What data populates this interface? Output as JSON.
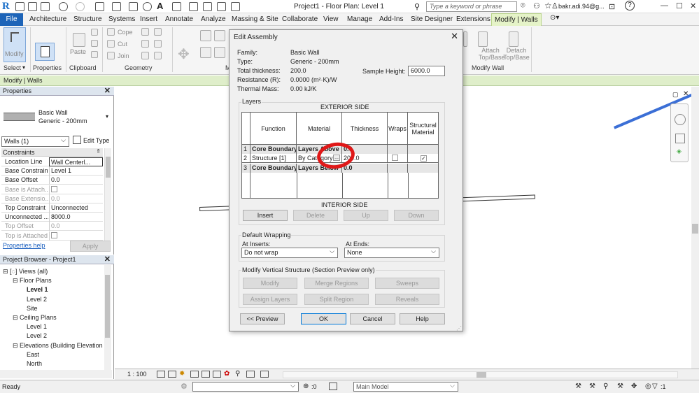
{
  "titlebar": {
    "logo": "R",
    "title": "Project1 - Floor Plan: Level 1",
    "search_placeholder": "Type a keyword or phrase",
    "user": "bakr.adi.94@g...",
    "help": "?",
    "minimize": "—",
    "maximize": "☐",
    "close": "✕"
  },
  "tabs": [
    "File",
    "Architecture",
    "Structure",
    "Systems",
    "Insert",
    "Annotate",
    "Analyze",
    "Massing & Site",
    "Collaborate",
    "View",
    "Manage",
    "Add-Ins",
    "Site Designer",
    "Extensions",
    "Modify | Walls"
  ],
  "ribbon": {
    "modify_label": "Modify",
    "paste_label": "Paste",
    "cope_label": "Cope",
    "cut_label": "Cut",
    "join_label": "Join",
    "attach_label": "Attach Top/Base",
    "detach_label": "Detach Top/Base",
    "group_select": "Select",
    "group_properties": "Properties",
    "group_clipboard": "Clipboard",
    "group_geometry": "Geometry",
    "group_modify": "M",
    "group_modify_wall": "Modify Wall"
  },
  "context": {
    "text": "Modify | Walls"
  },
  "properties": {
    "header": "Properties",
    "type_family": "Basic Wall",
    "type_name": "Generic - 200mm",
    "instance_selector": "Walls (1)",
    "edit_type": "Edit Type",
    "section": "Constraints",
    "rows": [
      {
        "k": "Location Line",
        "v": "Wall Centerl...",
        "dim": false
      },
      {
        "k": "Base Constraint",
        "v": "Level 1",
        "dim": false
      },
      {
        "k": "Base Offset",
        "v": "0.0",
        "dim": false
      },
      {
        "k": "Base is Attach...",
        "v": "",
        "dim": true,
        "check": true
      },
      {
        "k": "Base Extensio...",
        "v": "0.0",
        "dim": true
      },
      {
        "k": "Top Constraint",
        "v": "Unconnected",
        "dim": false
      },
      {
        "k": "Unconnected ...",
        "v": "8000.0",
        "dim": false
      },
      {
        "k": "Top Offset",
        "v": "0.0",
        "dim": true
      },
      {
        "k": "Top is Attached",
        "v": "",
        "dim": true,
        "check": true
      }
    ],
    "help_link": "Properties help",
    "apply": "Apply"
  },
  "browser": {
    "header": "Project Browser - Project1",
    "items": [
      {
        "label": "Views (all)",
        "level": 0
      },
      {
        "label": "Floor Plans",
        "level": 1
      },
      {
        "label": "Level 1",
        "level": 2,
        "bold": true
      },
      {
        "label": "Level 2",
        "level": 2
      },
      {
        "label": "Site",
        "level": 2
      },
      {
        "label": "Ceiling Plans",
        "level": 1
      },
      {
        "label": "Level 1",
        "level": 2
      },
      {
        "label": "Level 2",
        "level": 2
      },
      {
        "label": "Elevations (Building Elevation",
        "level": 1
      },
      {
        "label": "East",
        "level": 2
      },
      {
        "label": "North",
        "level": 2
      }
    ]
  },
  "viewbar": {
    "scale": "1 : 100"
  },
  "statusbar": {
    "status": "Ready",
    "zero": ":0",
    "model": "Main Model",
    "filter": ":1"
  },
  "dialog": {
    "title": "Edit Assembly",
    "family_label": "Family:",
    "family_value": "Basic Wall",
    "type_label": "Type:",
    "type_value": "Generic - 200mm",
    "thickness_label": "Total thickness:",
    "thickness_value": "200.0",
    "resistance_label": "Resistance (R):",
    "resistance_value": "0.0000 (m²·K)/W",
    "mass_label": "Thermal Mass:",
    "mass_value": "0.00 kJ/K",
    "sample_height_label": "Sample Height:",
    "sample_height_value": "6000.0",
    "layers_label": "Layers",
    "exterior_side": "EXTERIOR SIDE",
    "interior_side": "INTERIOR SIDE",
    "columns": [
      "Function",
      "Material",
      "Thickness",
      "Wraps",
      "Structural Material"
    ],
    "rows": [
      {
        "n": "1",
        "function": "Core Boundary",
        "material": "Layers Above",
        "thickness": "0.0",
        "core": true
      },
      {
        "n": "2",
        "function": "Structure [1]",
        "material": "By Category",
        "thickness": "200.0",
        "core": false,
        "structural": true
      },
      {
        "n": "3",
        "function": "Core Boundary",
        "material": "Layers Below",
        "thickness": "0.0",
        "core": true
      }
    ],
    "insert": "Insert",
    "delete": "Delete",
    "up": "Up",
    "down": "Down",
    "default_wrapping": "Default Wrapping",
    "at_inserts_label": "At Inserts:",
    "at_inserts_value": "Do not wrap",
    "at_ends_label": "At Ends:",
    "at_ends_value": "None",
    "modify_vertical": "Modify Vertical Structure (Section Preview only)",
    "modify": "Modify",
    "merge_regions": "Merge Regions",
    "sweeps": "Sweeps",
    "assign_layers": "Assign Layers",
    "split_region": "Split Region",
    "reveals": "Reveals",
    "preview": "<< Preview",
    "ok": "OK",
    "cancel": "Cancel",
    "help": "Help"
  },
  "colors": {
    "accent": "#1d64b8",
    "context": "#dfeeca",
    "annotation": "#e01818"
  }
}
